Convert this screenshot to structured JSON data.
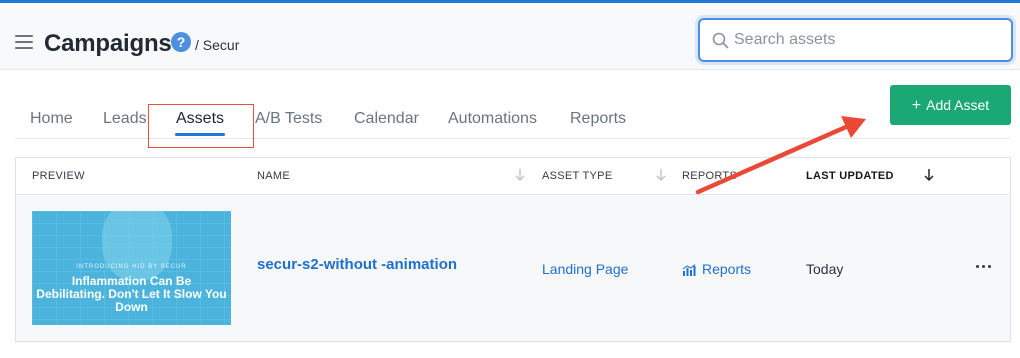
{
  "header": {
    "title": "Campaigns",
    "help_icon": "?",
    "breadcrumb": "/ Secur",
    "search_placeholder": "Search assets"
  },
  "tabs": [
    {
      "label": "Home"
    },
    {
      "label": "Leads"
    },
    {
      "label": "Assets",
      "active": true
    },
    {
      "label": "A/B Tests"
    },
    {
      "label": "Calendar"
    },
    {
      "label": "Automations"
    },
    {
      "label": "Reports"
    }
  ],
  "actions": {
    "add_asset_icon": "+",
    "add_asset_label": "Add Asset"
  },
  "table": {
    "columns": {
      "preview": "PREVIEW",
      "name": "NAME",
      "asset_type": "ASSET TYPE",
      "reports": "REPORTS",
      "last_updated": "LAST UPDATED"
    },
    "rows": [
      {
        "preview": {
          "kicker": "INTRODUCING HID BY SECUR",
          "headline": "Inflammation Can Be Debilitating. Don't Let It Slow You Down"
        },
        "name": "secur-s2-without -animation",
        "asset_type": "Landing Page",
        "reports": "Reports",
        "last_updated": "Today"
      }
    ]
  },
  "colors": {
    "accent": "#1f77d9",
    "button_green": "#1aa874",
    "link_blue": "#1f6fd1",
    "annotation_red": "#e8513f"
  },
  "icons": {
    "menu": "hamburger-icon",
    "help": "help-icon",
    "search": "search-icon",
    "sort": "sort-arrow-icon",
    "reports": "bar-chart-icon",
    "more": "more-options-icon"
  }
}
